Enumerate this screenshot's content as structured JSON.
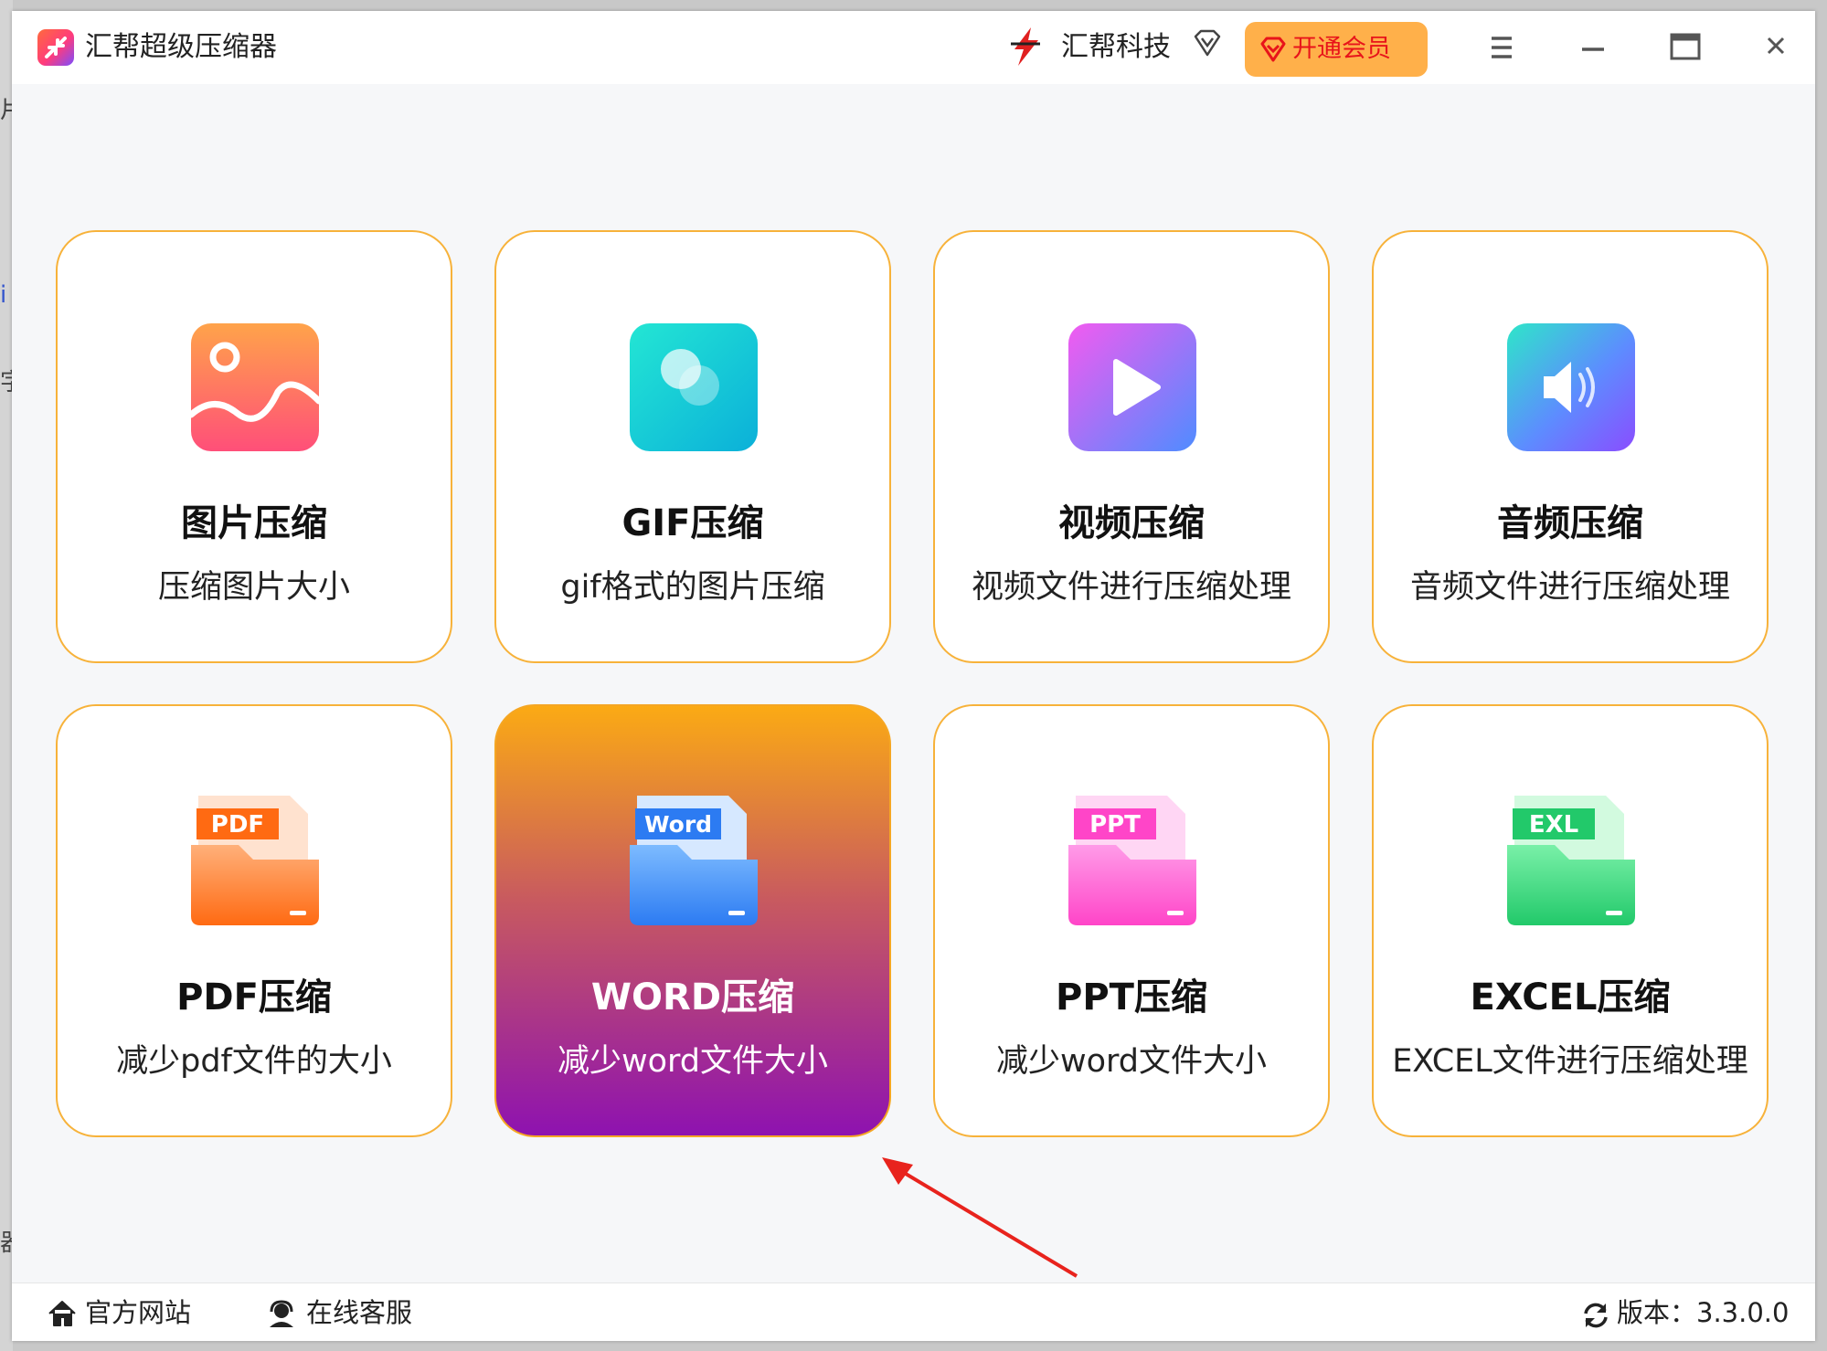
{
  "app": {
    "title": "汇帮超级压缩器"
  },
  "brand": {
    "name": "汇帮科技"
  },
  "vip": {
    "label": "开通会员"
  },
  "edge": {
    "marks": [
      "片",
      "i",
      "字",
      "器"
    ]
  },
  "cards": [
    {
      "title": "图片压缩",
      "desc": "压缩图片大小",
      "icon": "image-icon"
    },
    {
      "title": "GIF压缩",
      "desc": "gif格式的图片压缩",
      "icon": "gif-icon"
    },
    {
      "title": "视频压缩",
      "desc": "视频文件进行压缩处理",
      "icon": "video-play-icon"
    },
    {
      "title": "音频压缩",
      "desc": "音频文件进行压缩处理",
      "icon": "speaker-icon"
    },
    {
      "title": "PDF压缩",
      "desc": "减少pdf文件的大小",
      "icon": "pdf-folder-icon",
      "badge": "PDF"
    },
    {
      "title": "WORD压缩",
      "desc": "减少word文件大小",
      "icon": "word-folder-icon",
      "badge": "Word",
      "active": true
    },
    {
      "title": "PPT压缩",
      "desc": "减少word文件大小",
      "icon": "ppt-folder-icon",
      "badge": "PPT"
    },
    {
      "title": "EXCEL压缩",
      "desc": "EXCEL文件进行压缩处理",
      "icon": "excel-folder-icon",
      "badge": "EXL"
    }
  ],
  "footer": {
    "website": "官方网站",
    "support": "在线客服",
    "version": "版本：3.3.0.0"
  },
  "colors": {
    "card_border": "#f7b23a",
    "vip_bg": "#ffb04a",
    "vip_text": "#e8141a",
    "active_top": "#fbaa14",
    "active_bottom": "#8e12b0",
    "annotation_arrow": "#e8231d"
  }
}
